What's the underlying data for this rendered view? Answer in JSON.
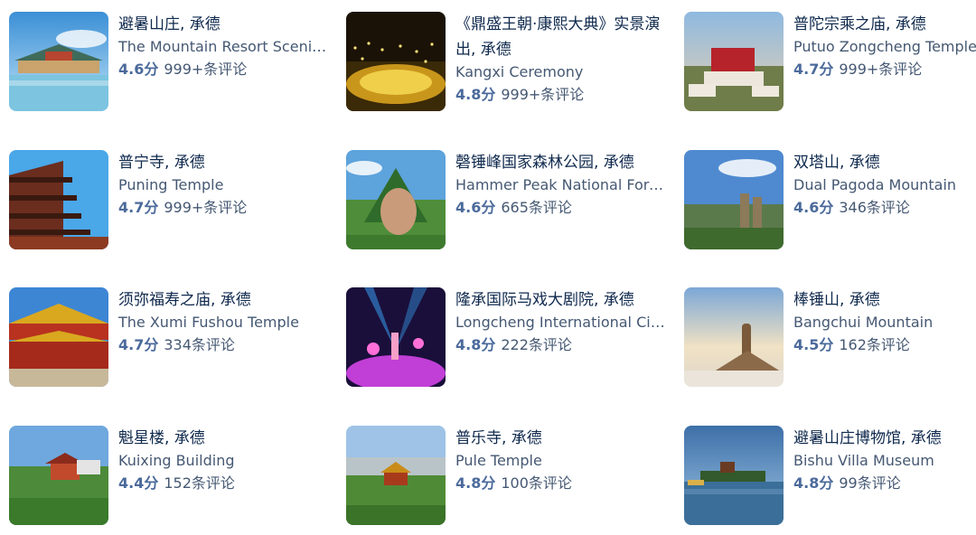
{
  "accent": "#4b6a9b",
  "score_suffix": "分",
  "attractions": [
    {
      "name_cn": "避暑山庄, 承德",
      "name_en": "The Mountain Resort Scenic Area",
      "score": "4.6",
      "reviews": "999+条评论"
    },
    {
      "name_cn": "《鼎盛王朝·康熙大典》实景演出, 承德",
      "name_en": "Kangxi Ceremony",
      "score": "4.8",
      "reviews": "999+条评论"
    },
    {
      "name_cn": "普陀宗乘之庙, 承德",
      "name_en": "Putuo Zongcheng Temple",
      "score": "4.7",
      "reviews": "999+条评论"
    },
    {
      "name_cn": "普宁寺, 承德",
      "name_en": "Puning Temple",
      "score": "4.7",
      "reviews": "999+条评论"
    },
    {
      "name_cn": "磬锤峰国家森林公园, 承德",
      "name_en": "Hammer Peak National Forest Park",
      "score": "4.6",
      "reviews": "665条评论"
    },
    {
      "name_cn": "双塔山, 承德",
      "name_en": "Dual Pagoda Mountain",
      "score": "4.6",
      "reviews": "346条评论"
    },
    {
      "name_cn": "须弥福寿之庙, 承德",
      "name_en": "The Xumi Fushou Temple",
      "score": "4.7",
      "reviews": "334条评论"
    },
    {
      "name_cn": "隆承国际马戏大剧院, 承德",
      "name_en": "Longcheng International Circus Theatre",
      "score": "4.8",
      "reviews": "222条评论"
    },
    {
      "name_cn": "棒锤山, 承德",
      "name_en": "Bangchui Mountain",
      "score": "4.5",
      "reviews": "162条评论"
    },
    {
      "name_cn": "魁星楼, 承德",
      "name_en": "Kuixing Building",
      "score": "4.4",
      "reviews": "152条评论"
    },
    {
      "name_cn": "普乐寺, 承德",
      "name_en": "Pule Temple",
      "score": "4.8",
      "reviews": "100条评论"
    },
    {
      "name_cn": "避暑山庄博物馆, 承德",
      "name_en": "Bishu Villa Museum",
      "score": "4.8",
      "reviews": "99条评论"
    }
  ]
}
